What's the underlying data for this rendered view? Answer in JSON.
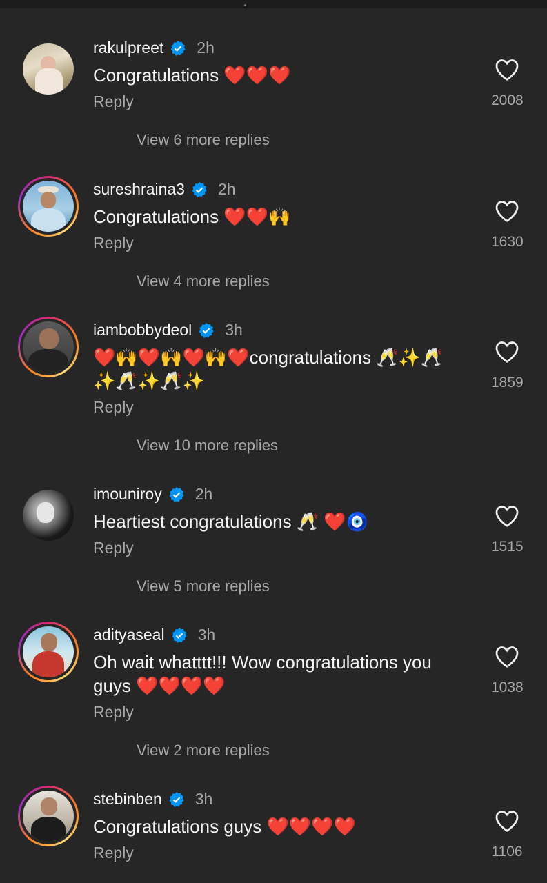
{
  "comments": [
    {
      "username": "rakulpreet",
      "time": "2h",
      "text": "Congratulations ❤️❤️❤️",
      "reply": "Reply",
      "view_more": "View 6 more replies",
      "likes": "2008"
    },
    {
      "username": "sureshraina3",
      "time": "2h",
      "text": "Congratulations ❤️❤️🙌",
      "reply": "Reply",
      "view_more": "View 4 more replies",
      "likes": "1630"
    },
    {
      "username": "iambobbydeol",
      "time": "3h",
      "text": "❤️🙌❤️🙌❤️🙌❤️congratulations 🥂✨🥂 ✨🥂✨🥂✨",
      "reply": "Reply",
      "view_more": "View 10 more replies",
      "likes": "1859"
    },
    {
      "username": "imouniroy",
      "time": "2h",
      "text": "Heartiest congratulations 🥂 ❤️🧿",
      "reply": "Reply",
      "view_more": "View 5 more replies",
      "likes": "1515"
    },
    {
      "username": "adityaseal",
      "time": "3h",
      "text": "Oh wait whatttt!!! Wow congratulations you guys ❤️❤️❤️❤️",
      "reply": "Reply",
      "view_more": "View 2 more replies",
      "likes": "1038"
    },
    {
      "username": "stebinben",
      "time": "3h",
      "text": "Congratulations guys ❤️❤️❤️❤️",
      "reply": "Reply",
      "likes": "1106"
    }
  ],
  "colors": {
    "background": "#262626",
    "verified": "#0095f6",
    "secondary_text": "#a8a8a8",
    "story_ring": "#d62976"
  }
}
